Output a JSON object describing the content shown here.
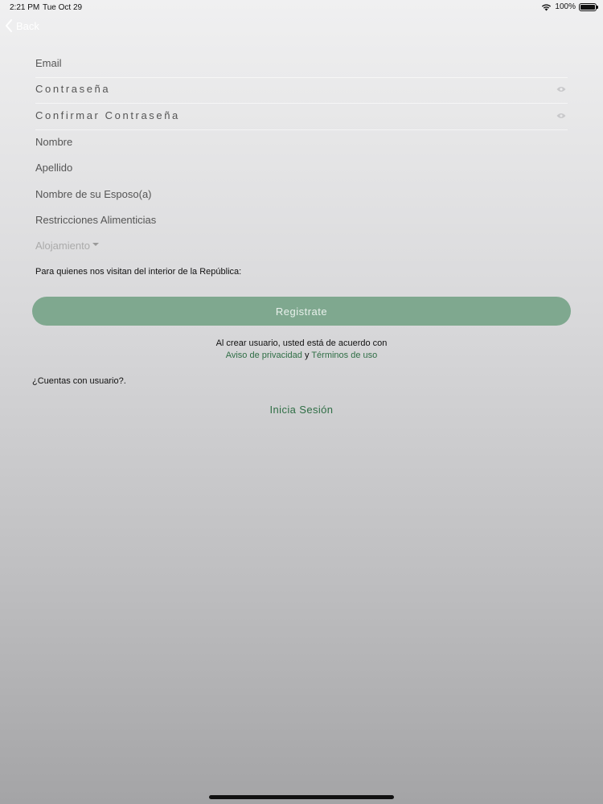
{
  "status_bar": {
    "time": "2:21 PM",
    "date": "Tue Oct 29",
    "battery": "100%"
  },
  "nav": {
    "back_label": "Back"
  },
  "form": {
    "email": "Email",
    "password": "Contraseña",
    "confirm_password": "Confirmar Contraseña",
    "first_name": "Nombre",
    "last_name": "Apellido",
    "spouse_name": "Nombre de su Esposo(a)",
    "dietary": "Restricciones Alimenticias",
    "lodging": "Alojamiento",
    "interior_note": "Para quienes nos visitan del interior de la República:"
  },
  "register_button": "Registrate",
  "agreement": {
    "text": "Al crear usuario, usted está de acuerdo con",
    "privacy": "Aviso de privacidad",
    "and": "y",
    "terms": "Términos de uso"
  },
  "login": {
    "prompt": "¿Cuentas con usuario?.",
    "button": "Inicia Sesión"
  },
  "colors": {
    "accent": "#2f6e45",
    "button_bg": "#7fa88f"
  }
}
